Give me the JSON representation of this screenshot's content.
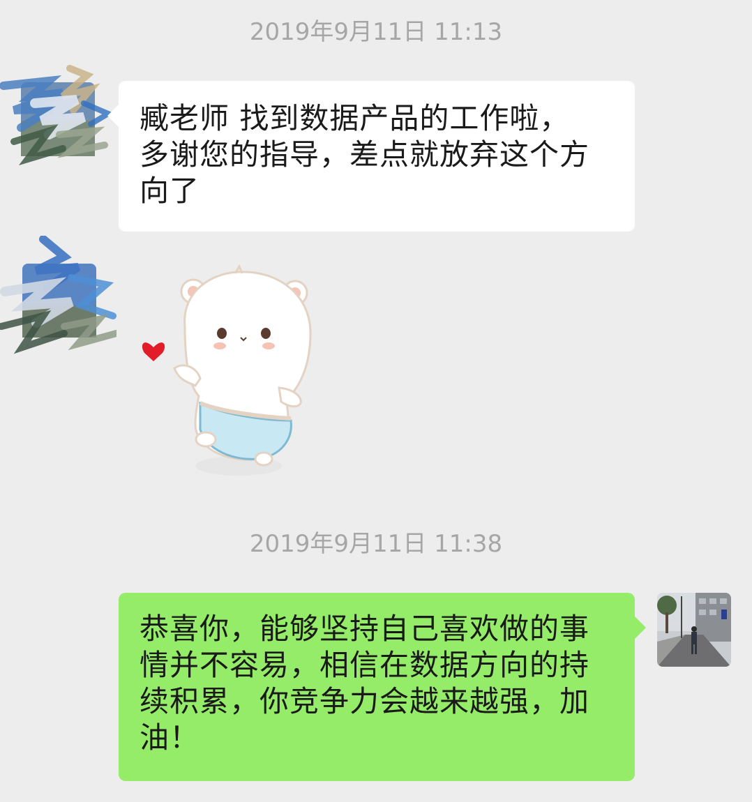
{
  "chat": {
    "timestamp_1": "2019年9月11日 11:13",
    "timestamp_2": "2019年9月11日 11:38",
    "messages": [
      {
        "sender": "contact",
        "text": "臧老师 找到数据产品的工作啦，\n多谢您的指导，差点就放弃这个方\n向了"
      },
      {
        "sender": "contact",
        "sticker": "bear-heart-sticker"
      },
      {
        "sender": "self",
        "text": "恭喜你，能够坚持自己喜欢做的事\n情并不容易，相信在数据方向的持\n续积累，你竞争力会越来越强，加\n油！"
      }
    ]
  },
  "colors": {
    "background": "#ededed",
    "self_bubble": "#95ec69",
    "contact_bubble": "#ffffff",
    "timestamp": "#a6a6a6"
  }
}
